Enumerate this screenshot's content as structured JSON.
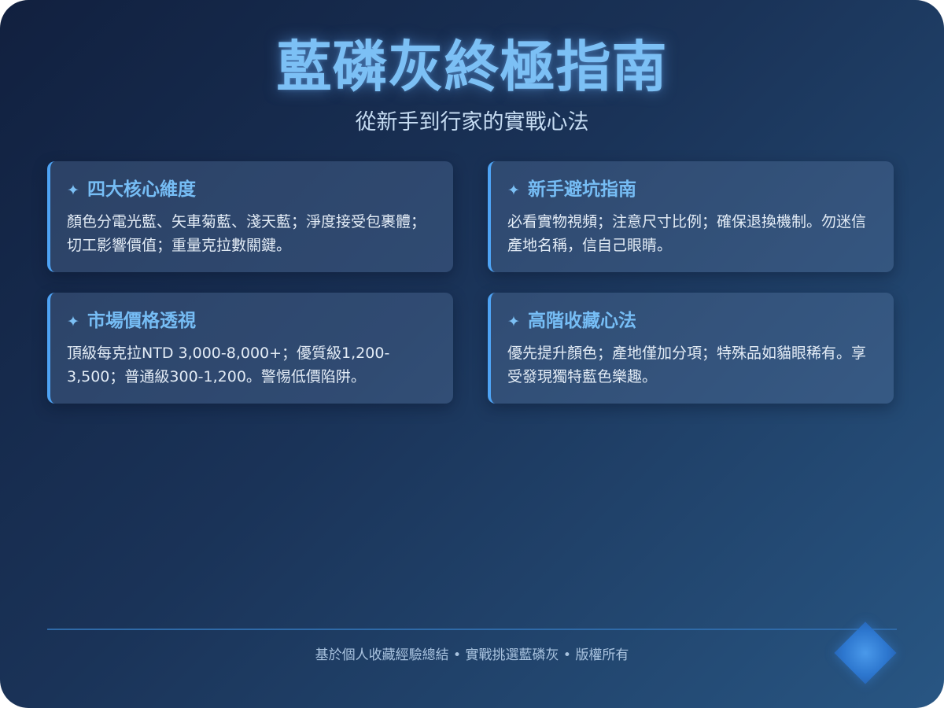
{
  "header": {
    "title": "藍磷灰終極指南",
    "subtitle": "從新手到行家的實戰心法"
  },
  "cards": [
    {
      "icon": "sparkle-icon",
      "sparkle": "✦",
      "title": "四大核心維度",
      "body": "顏色分電光藍、矢車菊藍、淺天藍；淨度接受包裹體；切工影響價值；重量克拉數關鍵。"
    },
    {
      "icon": "sparkle-icon",
      "sparkle": "✦",
      "title": "新手避坑指南",
      "body": "必看實物視頻；注意尺寸比例；確保退換機制。勿迷信產地名稱，信自己眼睛。"
    },
    {
      "icon": "sparkle-icon",
      "sparkle": "✦",
      "title": "市場價格透視",
      "body": "頂級每克拉NTD 3,000-8,000+；優質級1,200-3,500；普通級300-1,200。警惕低價陷阱。"
    },
    {
      "icon": "sparkle-icon",
      "sparkle": "✦",
      "title": "高階收藏心法",
      "body": "優先提升顏色；產地僅加分項；特殊品如貓眼稀有。享受發現獨特藍色樂趣。"
    }
  ],
  "footer": {
    "text": "基於個人收藏經驗總結 • 實戰挑選藍磷灰 • 版權所有"
  },
  "colors": {
    "accent": "#4ea3f4",
    "title": "#7cc0f5",
    "background_start": "#11203f",
    "background_end": "#285683"
  }
}
